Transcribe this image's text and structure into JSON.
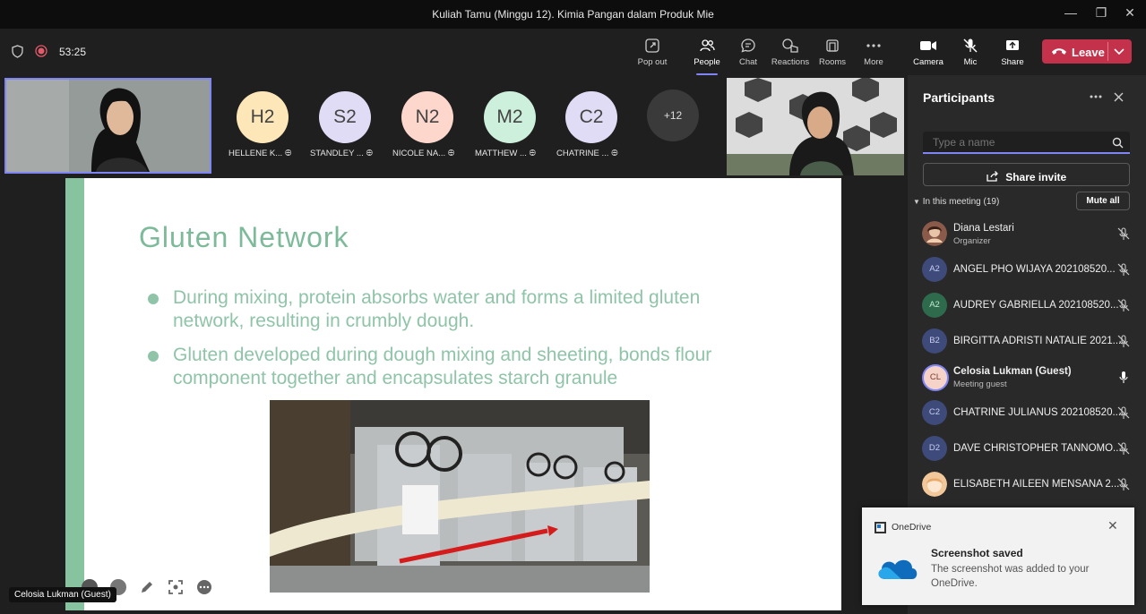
{
  "window": {
    "title": "Kuliah Tamu (Minggu 12). Kimia Pangan dalam Produk Mie"
  },
  "toolbar": {
    "timer": "53:25",
    "buttons": [
      {
        "label": "Pop out",
        "icon": "pop-out-icon"
      },
      {
        "label": "People",
        "icon": "people-icon",
        "active": true
      },
      {
        "label": "Chat",
        "icon": "chat-icon"
      },
      {
        "label": "Reactions",
        "icon": "reactions-icon"
      },
      {
        "label": "Rooms",
        "icon": "rooms-icon"
      },
      {
        "label": "More",
        "icon": "more-icon"
      },
      {
        "label": "Camera",
        "icon": "camera-icon"
      },
      {
        "label": "Mic",
        "icon": "mic-off-icon"
      },
      {
        "label": "Share",
        "icon": "share-icon"
      }
    ],
    "leave_label": "Leave",
    "leave_color": "#c4314b",
    "accent_color": "#7f85f5"
  },
  "gallery": {
    "tiles": [
      {
        "initials": "H2",
        "name": "HELLENE K...",
        "color": "#fde7b8"
      },
      {
        "initials": "S2",
        "name": "STANDLEY ...",
        "color": "#e0dcf5"
      },
      {
        "initials": "N2",
        "name": "NICOLE NA...",
        "color": "#fdd6cc"
      },
      {
        "initials": "M2",
        "name": "MATTHEW ...",
        "color": "#cdf0dc"
      },
      {
        "initials": "C2",
        "name": "CHATRINE ...",
        "color": "#e0dcf5"
      }
    ],
    "overflow": "+12"
  },
  "slide": {
    "title": "Gluten Network",
    "bullets": [
      "During mixing, protein absorbs water and forms a limited gluten network, resulting in crumbly dough.",
      "Gluten developed during dough mixing and sheeting, bonds flour component together and encapsulates starch granule"
    ]
  },
  "presenter_label": "Celosia Lukman (Guest)",
  "panel": {
    "title": "Participants",
    "search_placeholder": "Type a name",
    "share_invite": "Share invite",
    "in_meeting": "In this meeting (19)",
    "mute_all": "Mute all",
    "participants": [
      {
        "initials": "",
        "name": "Diana Lestari",
        "role": "Organizer",
        "avatar_color": "#8a5a4a",
        "mic": "off",
        "bold": false
      },
      {
        "initials": "A2",
        "name": "ANGEL PHO WIJAYA 202108520...",
        "role": "",
        "avatar_color": "#3d4a7a",
        "mic": "off",
        "bold": false
      },
      {
        "initials": "A2",
        "name": "AUDREY GABRIELLA 202108520...",
        "role": "",
        "avatar_color": "#2e6b4d",
        "mic": "off",
        "bold": false
      },
      {
        "initials": "B2",
        "name": "BIRGITTA ADRISTI NATALIE 2021...",
        "role": "",
        "avatar_color": "#3d4a7a",
        "mic": "off",
        "bold": false
      },
      {
        "initials": "CL",
        "name": "Celosia Lukman (Guest)",
        "role": "Meeting guest",
        "avatar_color": "#f6d3c8",
        "mic": "on",
        "bold": true
      },
      {
        "initials": "C2",
        "name": "CHATRINE JULIANUS 202108520...",
        "role": "",
        "avatar_color": "#3d4a7a",
        "mic": "off",
        "bold": false
      },
      {
        "initials": "D2",
        "name": "DAVE CHRISTOPHER TANNOMO...",
        "role": "",
        "avatar_color": "#3d4a7a",
        "mic": "off",
        "bold": false
      },
      {
        "initials": "",
        "name": "ELISABETH AILEEN MENSANA 2...",
        "role": "",
        "avatar_color": "#f2c79a",
        "mic": "off",
        "bold": false
      }
    ]
  },
  "toast": {
    "app": "OneDrive",
    "title": "Screenshot saved",
    "body": "The screenshot was added to your OneDrive."
  }
}
